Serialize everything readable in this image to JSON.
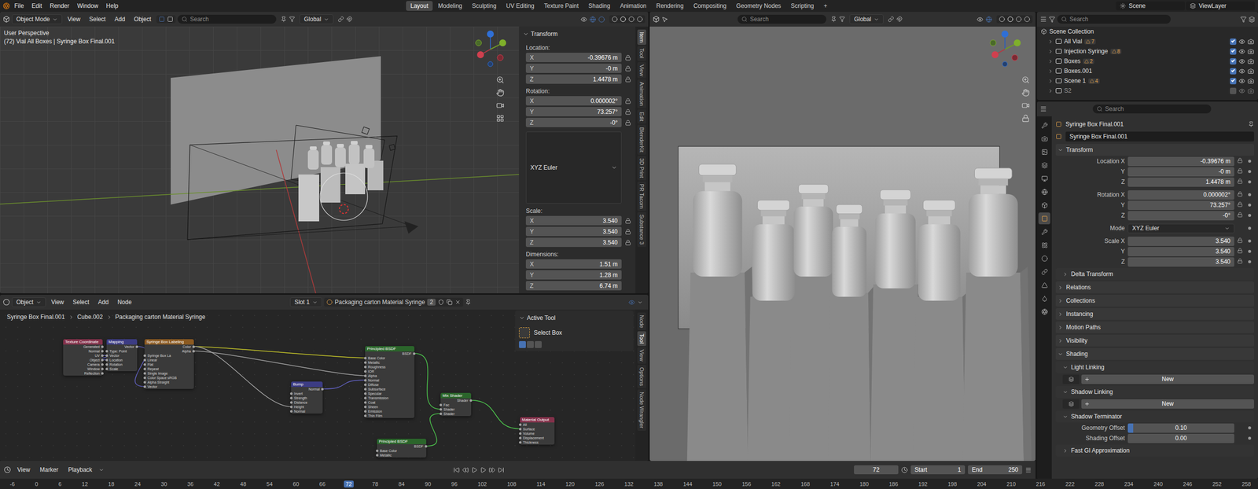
{
  "topbar": {
    "menus": [
      "File",
      "Edit",
      "Render",
      "Window",
      "Help"
    ],
    "workspaces": [
      {
        "label": "Layout",
        "selected": true
      },
      {
        "label": "Modeling",
        "selected": false
      },
      {
        "label": "Sculpting",
        "selected": false
      },
      {
        "label": "UV Editing",
        "selected": false
      },
      {
        "label": "Texture Paint",
        "selected": false
      },
      {
        "label": "Shading",
        "selected": false
      },
      {
        "label": "Animation",
        "selected": false
      },
      {
        "label": "Rendering",
        "selected": false
      },
      {
        "label": "Compositing",
        "selected": false
      },
      {
        "label": "Geometry Nodes",
        "selected": false
      },
      {
        "label": "Scripting",
        "selected": false
      }
    ],
    "add_workspace": "+",
    "scene": "Scene",
    "view_layer": "ViewLayer"
  },
  "viewport": {
    "mode": "Object Mode",
    "menus": [
      "View",
      "Select",
      "Add",
      "Object"
    ],
    "search": "Search",
    "orientation": "Global",
    "view_name": "User Perspective",
    "context": "(72) Vial All Boxes | Syringe Box Final.001",
    "sidebar": {
      "title": "Transform",
      "groups": [
        {
          "kind": "fields",
          "label": "Location:",
          "locks": true,
          "fields": [
            {
              "axis": "X",
              "value": "-0.39676 m"
            },
            {
              "axis": "Y",
              "value": "-0 m"
            },
            {
              "axis": "Z",
              "value": "1.4478 m"
            }
          ]
        },
        {
          "kind": "fields",
          "label": "Rotation:",
          "locks": true,
          "fields": [
            {
              "axis": "X",
              "value": "0.000002°"
            },
            {
              "axis": "Y",
              "value": "73.257°"
            },
            {
              "axis": "Z",
              "value": "-0°"
            }
          ]
        },
        {
          "kind": "dropdown",
          "value": "XYZ Euler"
        },
        {
          "kind": "fields",
          "label": "Scale:",
          "locks": true,
          "fields": [
            {
              "axis": "X",
              "value": "3.540"
            },
            {
              "axis": "Y",
              "value": "3.540"
            },
            {
              "axis": "Z",
              "value": "3.540"
            }
          ]
        },
        {
          "kind": "fields",
          "label": "Dimensions:",
          "locks": false,
          "fields": [
            {
              "axis": "X",
              "value": "1.51 m"
            },
            {
              "axis": "Y",
              "value": "1.28 m"
            },
            {
              "axis": "Z",
              "value": "6.74 m"
            }
          ]
        }
      ]
    },
    "tabs": [
      {
        "label": "Item",
        "selected": true
      },
      {
        "label": "Tool",
        "selected": false
      },
      {
        "label": "View",
        "selected": false
      },
      {
        "label": "Animation",
        "selected": false
      },
      {
        "label": "Edit",
        "selected": false
      },
      {
        "label": "BlenderKit",
        "selected": false
      },
      {
        "label": "3D Print",
        "selected": false
      },
      {
        "label": "PR Tacom",
        "selected": false
      },
      {
        "label": "Substance 3",
        "selected": false
      }
    ]
  },
  "node_editor": {
    "type": "Object",
    "menus": [
      "View",
      "Select",
      "Add",
      "Node"
    ],
    "slot": "Slot 1",
    "material": "Packaging carton Material Syringe",
    "users": "2",
    "breadcrumbs": [
      "Syringe Box Final.001",
      "Cube.002",
      "Packaging carton Material Syringe"
    ],
    "active_tool": {
      "title": "Active Tool",
      "tool": "Select Box"
    },
    "tabs": [
      {
        "label": "Node",
        "selected": false
      },
      {
        "label": "Tool",
        "selected": true
      },
      {
        "label": "View",
        "selected": false
      },
      {
        "label": "Options",
        "selected": false
      },
      {
        "label": "Node Wrangler",
        "selected": false
      }
    ],
    "nodes": [
      {
        "title": "Texture Coordinate",
        "color": "#83314a",
        "sockets": [
          {
            "label": "Generated",
            "kind": "output"
          },
          {
            "label": "Normal",
            "kind": "output"
          },
          {
            "label": "UV",
            "kind": "output"
          },
          {
            "label": "Object",
            "kind": "output"
          },
          {
            "label": "Camera",
            "kind": "output"
          },
          {
            "label": "Window",
            "kind": "output"
          },
          {
            "label": "Reflection",
            "kind": "output"
          }
        ]
      },
      {
        "title": "Mapping",
        "color": "#3c3c83",
        "sockets": [
          {
            "label": "Vector",
            "kind": "output"
          },
          {
            "label": "Type: Point",
            "kind": "input"
          },
          {
            "label": "Vector",
            "kind": "input"
          },
          {
            "label": "Location",
            "kind": "input"
          },
          {
            "label": "Rotation",
            "kind": "input"
          },
          {
            "label": "Scale",
            "kind": "input"
          }
        ]
      },
      {
        "title": "Syringe Box Labeling",
        "color": "#8b5a22",
        "sockets": [
          {
            "label": "Color",
            "kind": "output"
          },
          {
            "label": "Alpha",
            "kind": "output"
          },
          {
            "label": "Syringe Box La",
            "kind": "input"
          },
          {
            "label": "Linear",
            "kind": "input"
          },
          {
            "label": "Flat",
            "kind": "input"
          },
          {
            "label": "Repeat",
            "kind": "input"
          },
          {
            "label": "Single Image",
            "kind": "input"
          },
          {
            "label": "Color Space sRGB",
            "kind": "input"
          },
          {
            "label": "Alpha Straight",
            "kind": "input"
          },
          {
            "label": "Vector",
            "kind": "input"
          }
        ]
      },
      {
        "title": "Bump",
        "color": "#3c3c83",
        "sockets": [
          {
            "label": "Normal",
            "kind": "output"
          },
          {
            "label": "Invert",
            "kind": "input"
          },
          {
            "label": "Strength",
            "kind": "input"
          },
          {
            "label": "Distance",
            "kind": "input"
          },
          {
            "label": "Height",
            "kind": "input"
          },
          {
            "label": "Normal",
            "kind": "input"
          }
        ]
      },
      {
        "title": "Principled BSDF",
        "color": "#2b652b",
        "sockets": [
          {
            "label": "BSDF",
            "kind": "output"
          },
          {
            "label": "Base Color",
            "kind": "input"
          },
          {
            "label": "Metallic",
            "kind": "input"
          },
          {
            "label": "Roughness",
            "kind": "input"
          },
          {
            "label": "IOR",
            "kind": "input"
          },
          {
            "label": "Alpha",
            "kind": "input"
          },
          {
            "label": "Normal",
            "kind": "input"
          },
          {
            "label": "Diffuse",
            "kind": "input"
          },
          {
            "label": "Subsurface",
            "kind": "input"
          },
          {
            "label": "Specular",
            "kind": "input"
          },
          {
            "label": "Transmission",
            "kind": "input"
          },
          {
            "label": "Coat",
            "kind": "input"
          },
          {
            "label": "Sheen",
            "kind": "input"
          },
          {
            "label": "Emission",
            "kind": "input"
          },
          {
            "label": "Thin Film",
            "kind": "input"
          }
        ]
      },
      {
        "title": "Mix Shader",
        "color": "#2b652b",
        "sockets": [
          {
            "label": "Shader",
            "kind": "output"
          },
          {
            "label": "Fac",
            "kind": "input"
          },
          {
            "label": "Shader",
            "kind": "input"
          },
          {
            "label": "Shader",
            "kind": "input"
          }
        ]
      },
      {
        "title": "Material Output",
        "color": "#83314a",
        "sockets": [
          {
            "label": "All",
            "kind": "input"
          },
          {
            "label": "Surface",
            "kind": "input"
          },
          {
            "label": "Volume",
            "kind": "input"
          },
          {
            "label": "Displacement",
            "kind": "input"
          },
          {
            "label": "Thickness",
            "kind": "input"
          }
        ]
      },
      {
        "title": "Principled BSDF",
        "color": "#2b652b",
        "sockets": [
          {
            "label": "BSDF",
            "kind": "output"
          },
          {
            "label": "Base Color",
            "kind": "input"
          },
          {
            "label": "Metallic",
            "kind": "input"
          }
        ]
      }
    ]
  },
  "render_view": {
    "search": "Search",
    "orientation": "Global"
  },
  "outliner": {
    "search": "Search",
    "root": "Scene Collection",
    "items": [
      {
        "label": "All Vial",
        "count": "7",
        "expanded": false,
        "enabled": true
      },
      {
        "label": "Injection Syringe",
        "count": "8",
        "expanded": false,
        "enabled": true
      },
      {
        "label": "Boxes",
        "count": "2",
        "expanded": false,
        "enabled": true
      },
      {
        "label": "Boxes.001",
        "count": "",
        "expanded": false,
        "enabled": true
      },
      {
        "label": "Scene 1",
        "count": "4",
        "expanded": false,
        "enabled": true
      },
      {
        "label": "S2",
        "count": "",
        "expanded": false,
        "enabled": false
      }
    ]
  },
  "properties": {
    "search": "Search",
    "object": "Syringe Box Final.001",
    "name": "Syringe Box Final.001",
    "tabs": [
      {
        "selected": false
      },
      {
        "selected": false
      },
      {
        "selected": false
      },
      {
        "selected": false
      },
      {
        "selected": false
      },
      {
        "selected": false
      },
      {
        "selected": false
      },
      {
        "selected": true
      },
      {
        "selected": false
      },
      {
        "selected": false
      },
      {
        "selected": false
      },
      {
        "selected": false
      },
      {
        "selected": false
      },
      {
        "selected": false
      },
      {
        "selected": false
      }
    ],
    "panels": [
      {
        "title": "Transform",
        "nested": false,
        "expanded": true,
        "rows": [
          {
            "kind": "field",
            "label": "Location X",
            "value": "-0.39676 m"
          },
          {
            "kind": "field",
            "label": "Y",
            "value": "-0 m"
          },
          {
            "kind": "field",
            "label": "Z",
            "value": "1.4478 m"
          },
          {
            "kind": "field",
            "label": "Rotation X",
            "value": "0.000002°"
          },
          {
            "kind": "field",
            "label": "Y",
            "value": "73.257°"
          },
          {
            "kind": "field",
            "label": "Z",
            "value": "-0°"
          },
          {
            "kind": "dropdown",
            "label": "Mode",
            "value": "XYZ Euler"
          },
          {
            "kind": "field",
            "label": "Scale X",
            "value": "3.540"
          },
          {
            "kind": "field",
            "label": "Y",
            "value": "3.540"
          },
          {
            "kind": "field",
            "label": "Z",
            "value": "3.540"
          }
        ]
      },
      {
        "title": "Delta Transform",
        "nested": true,
        "expanded": false,
        "rows": []
      },
      {
        "title": "Relations",
        "nested": false,
        "expanded": false,
        "rows": []
      },
      {
        "title": "Collections",
        "nested": false,
        "expanded": false,
        "rows": []
      },
      {
        "title": "Instancing",
        "nested": false,
        "expanded": false,
        "rows": []
      },
      {
        "title": "Motion Paths",
        "nested": false,
        "expanded": false,
        "rows": []
      },
      {
        "title": "Visibility",
        "nested": false,
        "expanded": false,
        "rows": []
      },
      {
        "title": "Shading",
        "nested": false,
        "expanded": true,
        "rows": []
      },
      {
        "title": "Light Linking",
        "nested": true,
        "expanded": true,
        "rows": [
          {
            "kind": "button",
            "label": "New"
          }
        ]
      },
      {
        "title": "Shadow Linking",
        "nested": true,
        "expanded": true,
        "rows": [
          {
            "kind": "button",
            "label": "New"
          }
        ]
      },
      {
        "title": "Shadow Terminator",
        "nested": true,
        "expanded": true,
        "rows": [
          {
            "kind": "slider",
            "label": "Geometry Offset",
            "value": "0.10",
            "level": 0.05
          },
          {
            "kind": "slider",
            "label": "Shading Offset",
            "value": "0.00",
            "level": 0
          }
        ]
      },
      {
        "title": "Fast GI Approximation",
        "nested": true,
        "expanded": false,
        "rows": []
      }
    ]
  },
  "timeline": {
    "menus": [
      "View",
      "Marker",
      "Playback"
    ],
    "frame": "72",
    "start_label": "Start",
    "start": "1",
    "end_label": "End",
    "end": "250",
    "ruler": [
      "-6",
      "0",
      "6",
      "12",
      "18",
      "24",
      "30",
      "36",
      "42",
      "48",
      "54",
      "60",
      "66",
      "72",
      "78",
      "84",
      "90",
      "96",
      "102",
      "108",
      "114",
      "120",
      "126",
      "132",
      "138",
      "144",
      "150",
      "156",
      "162",
      "168",
      "174",
      "180",
      "186",
      "192",
      "198",
      "204",
      "210",
      "216",
      "222",
      "228",
      "234",
      "240",
      "246",
      "252",
      "258"
    ]
  }
}
